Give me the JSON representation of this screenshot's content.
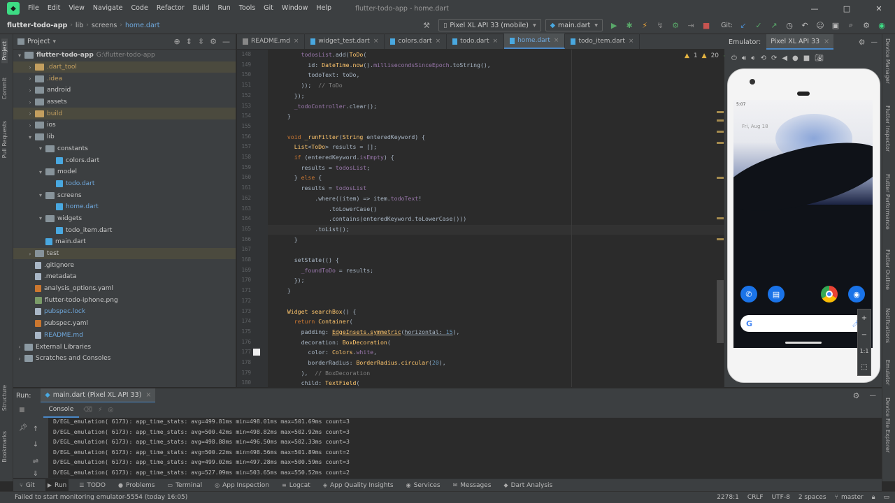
{
  "menubar": {
    "items": [
      "File",
      "Edit",
      "View",
      "Navigate",
      "Code",
      "Refactor",
      "Build",
      "Run",
      "Tools",
      "Git",
      "Window",
      "Help"
    ],
    "title": "flutter-todo-app - home.dart",
    "window_controls": [
      "—",
      "□",
      "✕"
    ]
  },
  "nav": {
    "breadcrumbs": [
      "flutter-todo-app",
      "lib",
      "screens",
      "home.dart"
    ],
    "device": "Pixel XL API 33 (mobile)",
    "run_config": "main.dart",
    "git_label": "Git:"
  },
  "left_tabs": [
    "Project",
    "Commit",
    "Pull Requests",
    "Structure",
    "Bookmarks"
  ],
  "project": {
    "title": "Project",
    "tree": [
      {
        "name": "flutter-todo-app",
        "extra": "G:\\flutter-todo-app",
        "indent": 0,
        "arrow": "▾",
        "icon": "folder",
        "cls": "",
        "row": ""
      },
      {
        "name": ".dart_tool",
        "indent": 1,
        "arrow": "›",
        "icon": "folder orange",
        "cls": "orange",
        "row": "hl"
      },
      {
        "name": ".idea",
        "indent": 1,
        "arrow": "›",
        "icon": "folder",
        "cls": "orange",
        "row": ""
      },
      {
        "name": "android",
        "indent": 1,
        "arrow": "›",
        "icon": "folder",
        "cls": "",
        "row": ""
      },
      {
        "name": "assets",
        "indent": 1,
        "arrow": "›",
        "icon": "folder",
        "cls": "",
        "row": ""
      },
      {
        "name": "build",
        "indent": 1,
        "arrow": "›",
        "icon": "folder orange",
        "cls": "orange",
        "row": "hl"
      },
      {
        "name": "ios",
        "indent": 1,
        "arrow": "›",
        "icon": "folder",
        "cls": "",
        "row": ""
      },
      {
        "name": "lib",
        "indent": 1,
        "arrow": "▾",
        "icon": "folder",
        "cls": "",
        "row": ""
      },
      {
        "name": "constants",
        "indent": 2,
        "arrow": "▾",
        "icon": "folder",
        "cls": "",
        "row": ""
      },
      {
        "name": "colors.dart",
        "indent": 3,
        "arrow": "",
        "icon": "dart",
        "cls": "",
        "row": ""
      },
      {
        "name": "model",
        "indent": 2,
        "arrow": "▾",
        "icon": "folder",
        "cls": "",
        "row": ""
      },
      {
        "name": "todo.dart",
        "indent": 3,
        "arrow": "",
        "icon": "dart",
        "cls": "blue",
        "row": ""
      },
      {
        "name": "screens",
        "indent": 2,
        "arrow": "▾",
        "icon": "folder",
        "cls": "",
        "row": ""
      },
      {
        "name": "home.dart",
        "indent": 3,
        "arrow": "",
        "icon": "dart",
        "cls": "blue",
        "row": ""
      },
      {
        "name": "widgets",
        "indent": 2,
        "arrow": "▾",
        "icon": "folder",
        "cls": "",
        "row": ""
      },
      {
        "name": "todo_item.dart",
        "indent": 3,
        "arrow": "",
        "icon": "dart",
        "cls": "",
        "row": ""
      },
      {
        "name": "main.dart",
        "indent": 2,
        "arrow": "",
        "icon": "dart",
        "cls": "",
        "row": ""
      },
      {
        "name": "test",
        "indent": 1,
        "arrow": "›",
        "icon": "folder",
        "cls": "",
        "row": "hl2"
      },
      {
        "name": ".gitignore",
        "indent": 1,
        "arrow": "",
        "icon": "gen",
        "cls": "",
        "row": ""
      },
      {
        "name": ".metadata",
        "indent": 1,
        "arrow": "",
        "icon": "gen",
        "cls": "",
        "row": ""
      },
      {
        "name": "analysis_options.yaml",
        "indent": 1,
        "arrow": "",
        "icon": "yml",
        "cls": "",
        "row": ""
      },
      {
        "name": "flutter-todo-iphone.png",
        "indent": 1,
        "arrow": "",
        "icon": "img",
        "cls": "",
        "row": ""
      },
      {
        "name": "pubspec.lock",
        "indent": 1,
        "arrow": "",
        "icon": "gen",
        "cls": "blue",
        "row": ""
      },
      {
        "name": "pubspec.yaml",
        "indent": 1,
        "arrow": "",
        "icon": "yml",
        "cls": "",
        "row": ""
      },
      {
        "name": "README.md",
        "indent": 1,
        "arrow": "",
        "icon": "gen",
        "cls": "blue",
        "row": ""
      },
      {
        "name": "External Libraries",
        "indent": 0,
        "arrow": "›",
        "icon": "lib",
        "cls": "",
        "row": ""
      },
      {
        "name": "Scratches and Consoles",
        "indent": 0,
        "arrow": "›",
        "icon": "lib",
        "cls": "",
        "row": ""
      }
    ]
  },
  "tabs": [
    {
      "label": "README.md",
      "kind": "m",
      "active": false
    },
    {
      "label": "widget_test.dart",
      "kind": "d",
      "active": false
    },
    {
      "label": "colors.dart",
      "kind": "d",
      "active": false
    },
    {
      "label": "todo.dart",
      "kind": "d",
      "active": false
    },
    {
      "label": "home.dart",
      "kind": "d",
      "active": true
    },
    {
      "label": "todo_item.dart",
      "kind": "d",
      "active": false
    }
  ],
  "inspections": {
    "warn": "1",
    "weak": "20",
    "ok": "1"
  },
  "code": [
    {
      "n": "148",
      "h": "      <span class='fld'>todosList</span>.add(<span class='fn'>ToDo</span>("
    },
    {
      "n": "149",
      "h": "        id: <span class='fn'>DateTime</span>.<span class='fn'>now</span>().<span class='fld'>millisecondsSinceEpoch</span>.toString(),"
    },
    {
      "n": "150",
      "h": "        todoText: toDo,"
    },
    {
      "n": "151",
      "h": "      ));  <span class='cm'>// ToDo</span>"
    },
    {
      "n": "152",
      "h": "    });"
    },
    {
      "n": "153",
      "h": "    <span class='fld'>_todoController</span>.clear();"
    },
    {
      "n": "154",
      "h": "  }"
    },
    {
      "n": "155",
      "h": ""
    },
    {
      "n": "156",
      "h": "  <span class='kw'>void</span> <span class='fn'>_runFilter</span>(<span class='fn'>String</span> enteredKeyword) {"
    },
    {
      "n": "157",
      "h": "    <span class='fn'>List</span>&lt;<span class='fn'>ToDo</span>&gt; results = [];"
    },
    {
      "n": "158",
      "h": "    <span class='kw'>if</span> (enteredKeyword.<span class='fld'>isEmpty</span>) {"
    },
    {
      "n": "159",
      "h": "      results = <span class='fld'>todosList</span>;"
    },
    {
      "n": "160",
      "h": "    } <span class='kw'>else</span> {"
    },
    {
      "n": "161",
      "h": "      results = <span class='fld'>todosList</span>"
    },
    {
      "n": "162",
      "h": "          .where((item) =&gt; item.<span class='fld'>todoText</span>!"
    },
    {
      "n": "163",
      "h": "              .toLowerCase()"
    },
    {
      "n": "164",
      "h": "              .contains(enteredKeyword.toLowerCase()))"
    },
    {
      "n": "165",
      "h": "          .toList();"
    },
    {
      "n": "166",
      "h": "    }"
    },
    {
      "n": "167",
      "h": ""
    },
    {
      "n": "168",
      "h": "    setState(() {"
    },
    {
      "n": "169",
      "h": "      <span class='fld'>_foundToDo</span> = results;"
    },
    {
      "n": "170",
      "h": "    });"
    },
    {
      "n": "171",
      "h": "  }"
    },
    {
      "n": "172",
      "h": ""
    },
    {
      "n": "173",
      "h": "  <span class='fn'>Widget</span> <span class='fn'>searchBox</span>() {"
    },
    {
      "n": "174",
      "h": "    <span class='kw'>return</span> <span class='fn'>Container</span>("
    },
    {
      "n": "175",
      "h": "      padding: <span class='fn un'>EdgeInsets.symmetric</span>(<span class='un'>horizontal: <span class='num'>15</span></span>),"
    },
    {
      "n": "176",
      "h": "      decoration: <span class='fn'>BoxDecoration</span>("
    },
    {
      "n": "177",
      "h": "        color: <span class='fn'>Colors</span>.<span class='fld'>white</span>,"
    },
    {
      "n": "178",
      "h": "        borderRadius: <span class='fn'>BorderRadius</span>.<span class='fn'>circular</span>(<span class='num'>20</span>),"
    },
    {
      "n": "179",
      "h": "      ),  <span class='cm'>// BoxDecoration</span>"
    },
    {
      "n": "180",
      "h": "      child: <span class='fn'>TextField</span>("
    }
  ],
  "emulator": {
    "label": "Emulator:",
    "device_tab": "Pixel XL API 33",
    "time": "5:07",
    "date": "Fri, Aug 18",
    "zoom": [
      "+",
      "−",
      "1:1",
      "⬚"
    ]
  },
  "right_tabs": [
    "Device Manager",
    "Flutter Inspector",
    "Flutter Performance",
    "Flutter Outline",
    "Notifications",
    "Emulator",
    "Device File Explorer"
  ],
  "run": {
    "label": "Run:",
    "config_tab": "main.dart (Pixel XL API 33)",
    "console_tab": "Console",
    "logs": [
      "D/EGL_emulation( 6173): app_time_stats: avg=499.81ms min=498.01ms max=501.69ms count=3",
      "D/EGL_emulation( 6173): app_time_stats: avg=500.42ms min=498.82ms max=502.92ms count=3",
      "D/EGL_emulation( 6173): app_time_stats: avg=498.88ms min=496.50ms max=502.33ms count=3",
      "D/EGL_emulation( 6173): app_time_stats: avg=500.22ms min=498.56ms max=501.89ms count=2",
      "D/EGL_emulation( 6173): app_time_stats: avg=499.02ms min=497.28ms max=500.59ms count=3",
      "D/EGL_emulation( 6173): app_time_stats: avg=527.09ms min=503.65ms max=550.52ms count=2"
    ]
  },
  "bottom_tools": [
    {
      "label": "Git",
      "icon": "⑂",
      "active": false
    },
    {
      "label": "Run",
      "icon": "▶",
      "active": true
    },
    {
      "label": "TODO",
      "icon": "☰",
      "active": false
    },
    {
      "label": "Problems",
      "icon": "●",
      "active": false
    },
    {
      "label": "Terminal",
      "icon": "▭",
      "active": false
    },
    {
      "label": "App Inspection",
      "icon": "◎",
      "active": false
    },
    {
      "label": "Logcat",
      "icon": "≡",
      "active": false
    },
    {
      "label": "App Quality Insights",
      "icon": "◈",
      "active": false
    },
    {
      "label": "Services",
      "icon": "◉",
      "active": false
    },
    {
      "label": "Messages",
      "icon": "✉",
      "active": false
    },
    {
      "label": "Dart Analysis",
      "icon": "◆",
      "active": false
    }
  ],
  "status": {
    "message": "Failed to start monitoring emulator-5554 (today 16:05)",
    "position": "2278:1",
    "line_sep": "CRLF",
    "encoding": "UTF-8",
    "indent": "2 spaces",
    "branch": "master"
  }
}
